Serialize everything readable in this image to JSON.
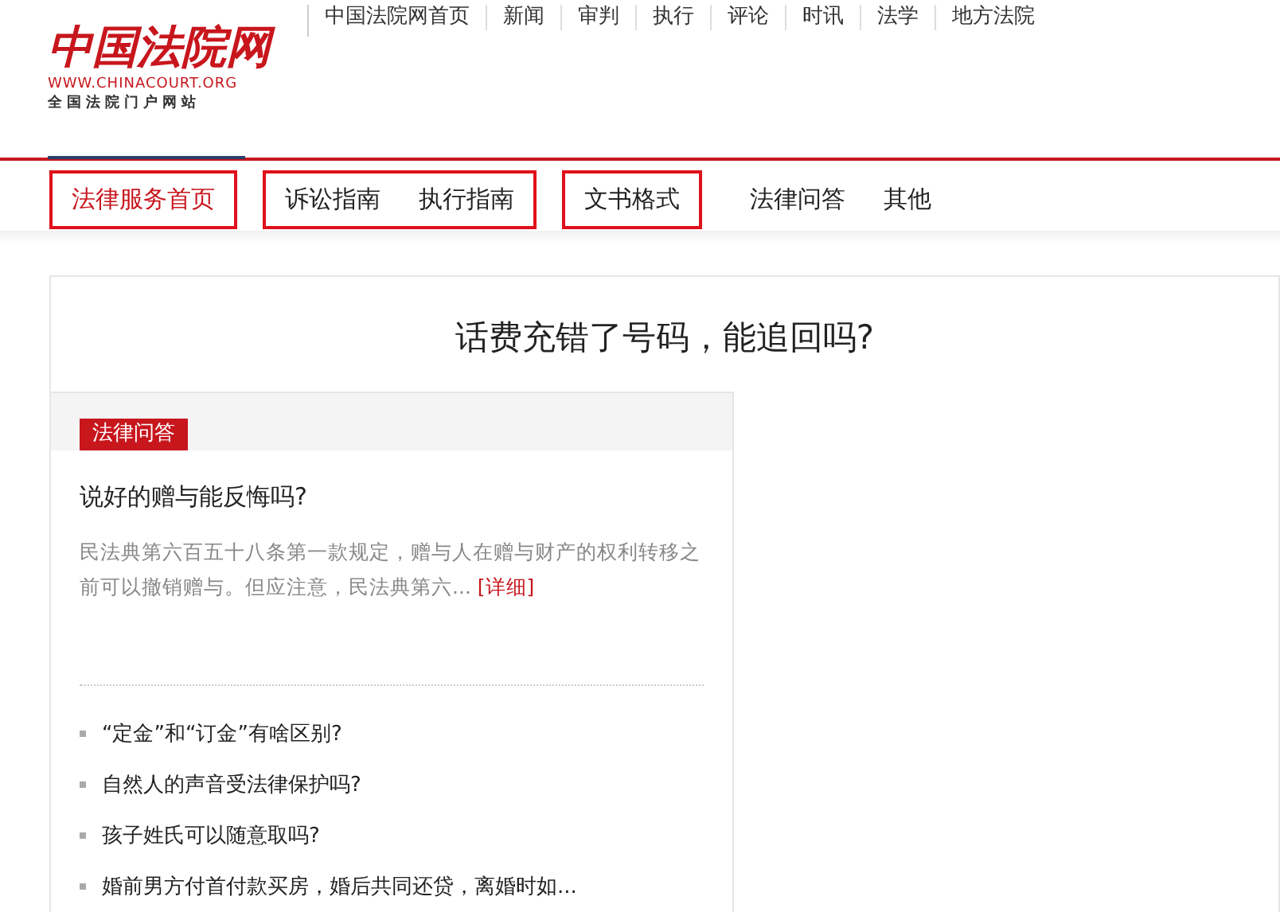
{
  "logo": {
    "title": "中国法院网",
    "url": "WWW.CHINACOURT.ORG",
    "subtitle": "全国法院门户网站"
  },
  "top_links": [
    "中国法院网首页",
    "新闻",
    "审判",
    "执行",
    "评论",
    "时讯",
    "法学",
    "地方法院"
  ],
  "nav_groups": [
    {
      "outlined": true,
      "items": [
        {
          "label": "法律服务首页",
          "selected": true
        }
      ]
    },
    {
      "outlined": true,
      "items": [
        {
          "label": "诉讼指南",
          "selected": false
        },
        {
          "label": "执行指南",
          "selected": false
        }
      ]
    },
    {
      "outlined": true,
      "items": [
        {
          "label": "文书格式",
          "selected": false
        }
      ]
    },
    {
      "outlined": false,
      "items": [
        {
          "label": "法律问答",
          "selected": false
        },
        {
          "label": "其他",
          "selected": false
        }
      ]
    }
  ],
  "page_title": "话费充错了号码，能追回吗?",
  "card": {
    "tag": "法律问答",
    "headline": "说好的赠与能反悔吗?",
    "summary": "民法典第六百五十八条第一款规定，赠与人在赠与财产的权利转移之前可以撤销赠与。但应注意，民法典第六...",
    "more_link": "[详细]",
    "list": [
      "“定金”和“订金”有啥区别?",
      "自然人的声音受法律保护吗?",
      "孩子姓氏可以随意取吗?",
      "婚前男方付首付款买房，婚后共同还贷，离婚时如..."
    ]
  }
}
